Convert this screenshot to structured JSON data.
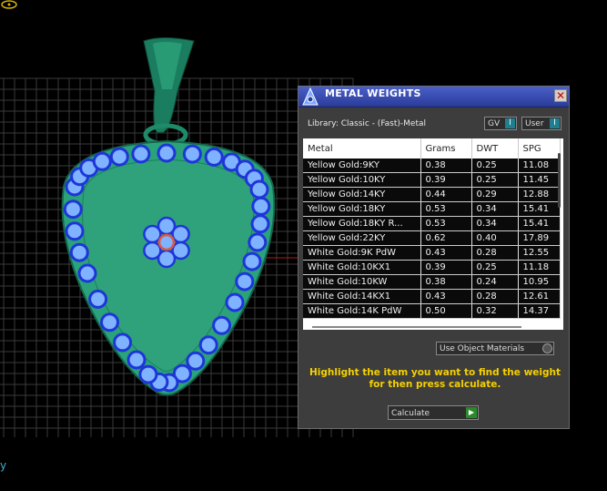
{
  "panel": {
    "title": "METAL WEIGHTS",
    "app_icon": "metal-weights-logo-icon",
    "close_glyph": "✕",
    "library_label": "Library: Classic - (Fast)-Metal",
    "gv_toggle": {
      "label": "GV",
      "glyph": "I"
    },
    "user_toggle": {
      "label": "User",
      "glyph": "I"
    },
    "columns": [
      "Metal",
      "Grams",
      "DWT",
      "SPG"
    ],
    "rows": [
      [
        "Yellow Gold:9KY",
        "0.38",
        "0.25",
        "11.08"
      ],
      [
        "Yellow Gold:10KY",
        "0.39",
        "0.25",
        "11.45"
      ],
      [
        "Yellow Gold:14KY",
        "0.44",
        "0.29",
        "12.88"
      ],
      [
        "Yellow Gold:18KY",
        "0.53",
        "0.34",
        "15.41"
      ],
      [
        "Yellow Gold:18KY R...",
        "0.53",
        "0.34",
        "15.41"
      ],
      [
        "Yellow Gold:22KY",
        "0.62",
        "0.40",
        "17.89"
      ],
      [
        "White Gold:9K PdW",
        "0.43",
        "0.28",
        "12.55"
      ],
      [
        "White Gold:10KX1",
        "0.39",
        "0.25",
        "11.18"
      ],
      [
        "White Gold:10KW",
        "0.38",
        "0.24",
        "10.95"
      ],
      [
        "White Gold:14KX1",
        "0.43",
        "0.28",
        "12.61"
      ],
      [
        "White Gold:14K PdW",
        "0.50",
        "0.32",
        "14.37"
      ]
    ],
    "use_object_materials": "Use Object Materials",
    "hint_line1": "Highlight the item you want to find the weight",
    "hint_line2": "for then press calculate.",
    "calculate_label": "Calculate",
    "calculate_glyph": "▶"
  },
  "viewport": {
    "grid_color": "#3a3a3a",
    "pendant_fill": "#2aa37a",
    "bead_color": "#1e35d8",
    "bead_highlight": "#7fb2ff",
    "axis_glyph": "y",
    "corner_icon": "viewport-gizmo-icon"
  }
}
